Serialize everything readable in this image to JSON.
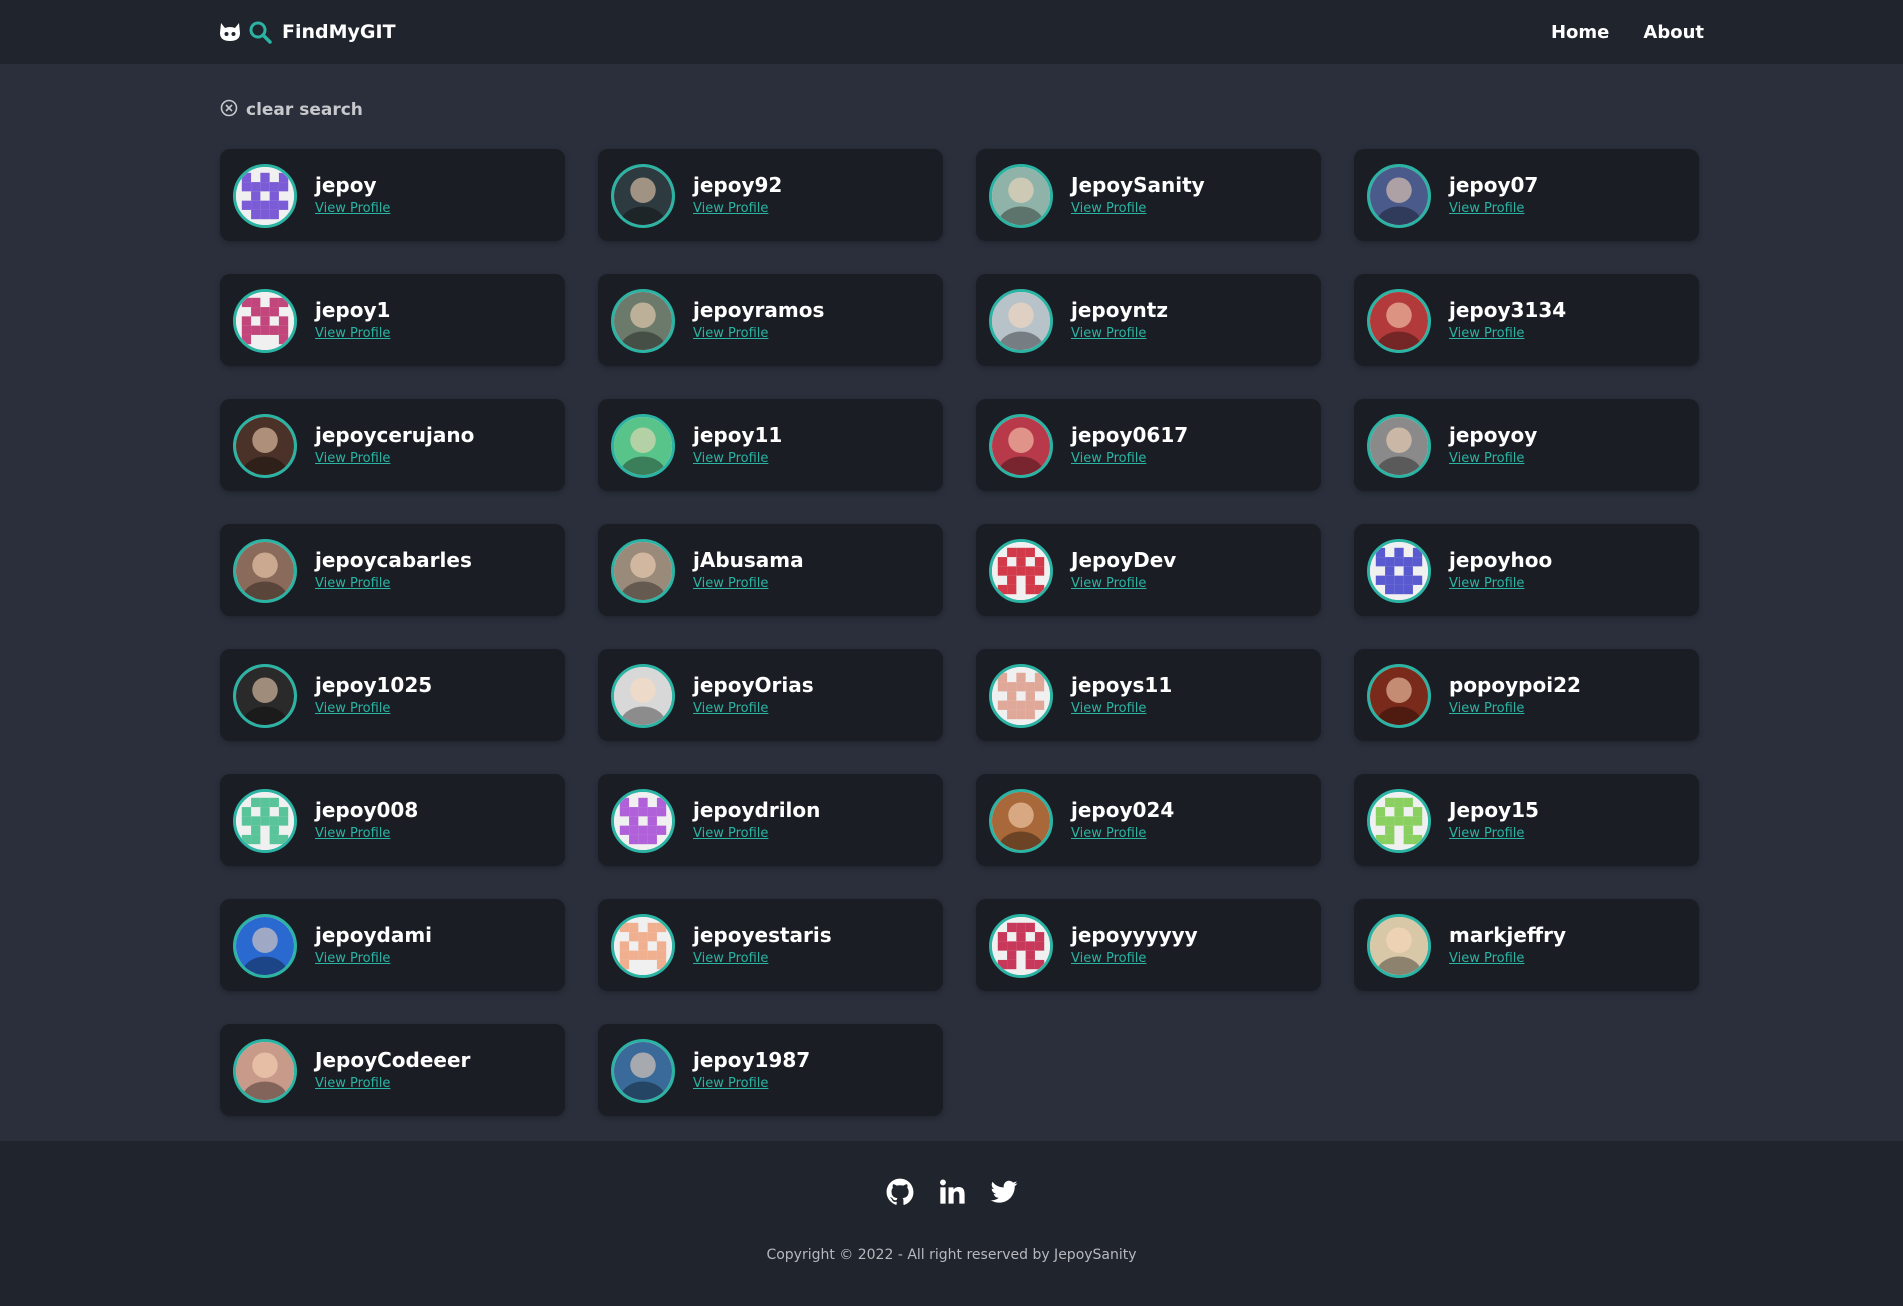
{
  "header": {
    "brand": "FindMyGIT",
    "nav": [
      "Home",
      "About"
    ]
  },
  "search": {
    "clear_label": "clear search"
  },
  "colors": {
    "accent": "#2bb3a3",
    "card": "#1a1d23",
    "background": "#2a2f3b",
    "navbar": "#20242c"
  },
  "view_profile_label": "View Profile",
  "users": [
    {
      "name": "jepoy",
      "avatar": {
        "kind": "identicon",
        "color": "#7b5cd6"
      }
    },
    {
      "name": "jepoy92",
      "avatar": {
        "kind": "photo",
        "color": "#2d3a3f"
      }
    },
    {
      "name": "JepoySanity",
      "avatar": {
        "kind": "photo",
        "color": "#8fb3a8"
      }
    },
    {
      "name": "jepoy07",
      "avatar": {
        "kind": "photo",
        "color": "#4a5a8a"
      }
    },
    {
      "name": "jepoy1",
      "avatar": {
        "kind": "identicon",
        "color": "#c2457b"
      }
    },
    {
      "name": "jepoyramos",
      "avatar": {
        "kind": "photo",
        "color": "#6b7a6a"
      }
    },
    {
      "name": "jepoyntz",
      "avatar": {
        "kind": "photo",
        "color": "#b7c2c9"
      }
    },
    {
      "name": "jepoy3134",
      "avatar": {
        "kind": "photo",
        "color": "#b33a3a"
      }
    },
    {
      "name": "jepoycerujano",
      "avatar": {
        "kind": "photo",
        "color": "#4a3228"
      }
    },
    {
      "name": "jepoy11",
      "avatar": {
        "kind": "photo",
        "color": "#59c48a"
      }
    },
    {
      "name": "jepoy0617",
      "avatar": {
        "kind": "photo",
        "color": "#b83a4a"
      }
    },
    {
      "name": "jepoyoy",
      "avatar": {
        "kind": "photo",
        "color": "#8a8a8a"
      }
    },
    {
      "name": "jepoycabarles",
      "avatar": {
        "kind": "photo",
        "color": "#8a6a5a"
      }
    },
    {
      "name": "jAbusama",
      "avatar": {
        "kind": "photo",
        "color": "#9a8a7a"
      }
    },
    {
      "name": "JepoyDev",
      "avatar": {
        "kind": "identicon",
        "color": "#d23a4a"
      }
    },
    {
      "name": "jepoyhoo",
      "avatar": {
        "kind": "identicon",
        "color": "#5a5ad0"
      }
    },
    {
      "name": "jepoy1025",
      "avatar": {
        "kind": "photo",
        "color": "#2a2a2a"
      }
    },
    {
      "name": "jepoyOrias",
      "avatar": {
        "kind": "photo",
        "color": "#d8d8d8"
      }
    },
    {
      "name": "jepoys11",
      "avatar": {
        "kind": "identicon",
        "color": "#e0a898"
      }
    },
    {
      "name": "popoypoi22",
      "avatar": {
        "kind": "photo",
        "color": "#7a2a1a"
      }
    },
    {
      "name": "jepoy008",
      "avatar": {
        "kind": "identicon",
        "color": "#59c49a"
      }
    },
    {
      "name": "jepoydrilon",
      "avatar": {
        "kind": "identicon",
        "color": "#b060d8"
      }
    },
    {
      "name": "jepoy024",
      "avatar": {
        "kind": "photo",
        "color": "#a8683a"
      }
    },
    {
      "name": "Jepoy15",
      "avatar": {
        "kind": "identicon",
        "color": "#8ad060"
      }
    },
    {
      "name": "jepoydami",
      "avatar": {
        "kind": "photo",
        "color": "#2a6ad0"
      }
    },
    {
      "name": "jepoyestaris",
      "avatar": {
        "kind": "identicon",
        "color": "#f0b090"
      }
    },
    {
      "name": "jepoyyyyyy",
      "avatar": {
        "kind": "identicon",
        "color": "#c8385a"
      }
    },
    {
      "name": "markjeffry",
      "avatar": {
        "kind": "photo",
        "color": "#d8c8a8"
      }
    },
    {
      "name": "JepoyCodeeer",
      "avatar": {
        "kind": "photo",
        "color": "#c89a8a"
      }
    },
    {
      "name": "jepoy1987",
      "avatar": {
        "kind": "photo",
        "color": "#3a6a9a"
      }
    }
  ],
  "footer": {
    "social": [
      "github-icon",
      "linkedin-icon",
      "twitter-icon"
    ],
    "copyright": "Copyright © 2022 - All right reserved by JepoySanity"
  }
}
